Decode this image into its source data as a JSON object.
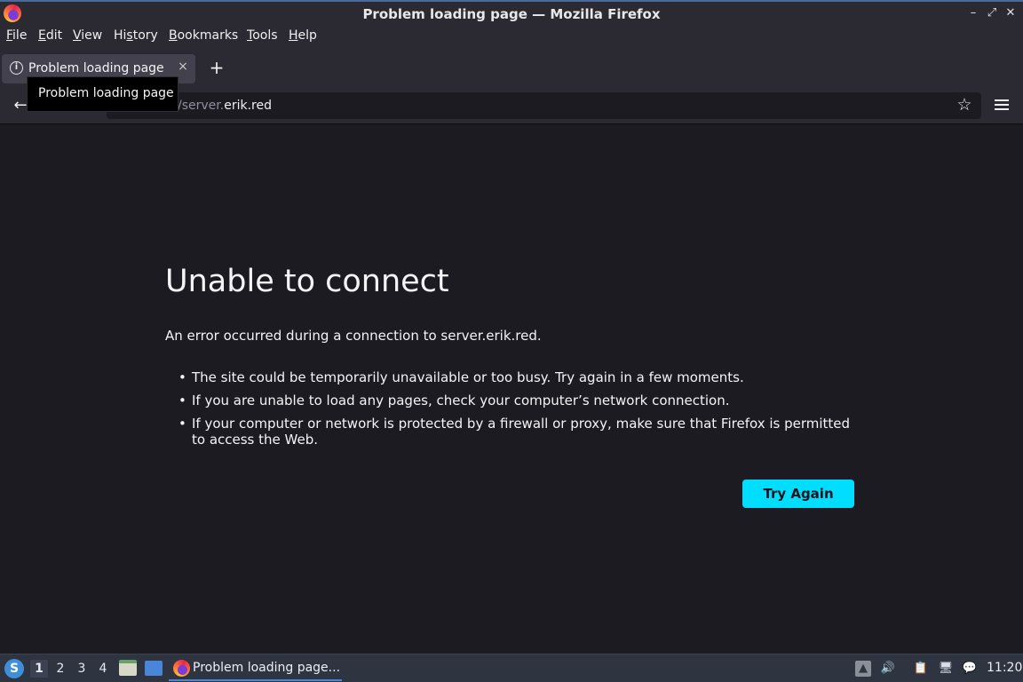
{
  "window": {
    "title": "Problem loading page — Mozilla Firefox",
    "controls": [
      "–",
      "⤢",
      "✕"
    ]
  },
  "menubar": {
    "items": [
      {
        "label": "File",
        "accesskey": "F",
        "rest": "ile"
      },
      {
        "label": "Edit",
        "accesskey": "E",
        "rest": "dit"
      },
      {
        "label": "View",
        "accesskey": "V",
        "rest": "iew"
      },
      {
        "label": "History",
        "accesskey": "s",
        "pre": "Hi",
        "rest": "tory"
      },
      {
        "label": "Bookmarks",
        "accesskey": "B",
        "rest": "ookmarks"
      },
      {
        "label": "Tools",
        "accesskey": "T",
        "rest": "ools"
      },
      {
        "label": "Help",
        "accesskey": "H",
        "rest": "elp"
      }
    ]
  },
  "tabs": [
    {
      "label": "Problem loading page",
      "icon": "info-icon",
      "close": "×"
    }
  ],
  "newtab": "+",
  "tooltip": "Problem loading page",
  "navbar": {
    "back": "←",
    "url_prefix": "/server.",
    "url_host": "erik.red",
    "bookmark_star": "☆"
  },
  "error": {
    "title": "Unable to connect",
    "description": "An error occurred during a connection to server.erik.red.",
    "bullets": [
      "The site could be temporarily unavailable or too busy. Try again in a few moments.",
      "If you are unable to load any pages, check your computer’s network connection.",
      "If your computer or network is protected by a firewall or proxy, make sure that Firefox is permitted to access the Web."
    ],
    "try_again": "Try Again"
  },
  "taskbar": {
    "workspaces": [
      "1",
      "2",
      "3",
      "4"
    ],
    "active_workspace": "1",
    "task_label": "Problem loading page...",
    "clock": "11:20"
  },
  "colors": {
    "accent": "#00ddff",
    "page_bg": "#1c1b22",
    "chrome_bg": "#2b2a33"
  }
}
